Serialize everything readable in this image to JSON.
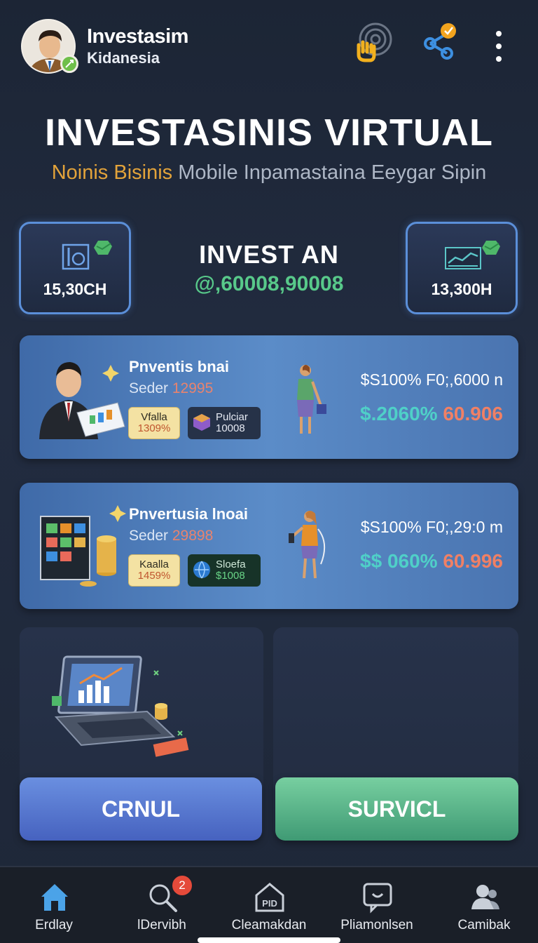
{
  "header": {
    "brand_title": "Investasim",
    "brand_sub": "Kidanesia"
  },
  "hero": {
    "title": "INVESTASINIS VIRTUAL",
    "subtitle_accent": "Noinis Bisinis",
    "subtitle_rest": " Mobile Inpamastaina Eeygar Sipin"
  },
  "stats": {
    "left_value": "15,30CH",
    "right_value": "13,300H",
    "center_label": "INVEST AN",
    "center_value": "@,60008,90008"
  },
  "cards": [
    {
      "name": "Pnventis bnai",
      "sub_label": "Seder ",
      "sub_number": "12995",
      "chip1_label": "Vfalla",
      "chip1_value": "1309%",
      "chip2_label": "Pulciar",
      "chip2_value": "10008",
      "stat_line": "$S100% F0;,6000 n",
      "stat_green": "$.2060%",
      "stat_red": " 60.906"
    },
    {
      "name": "Pnvertusia lnoai",
      "sub_label": "Seder ",
      "sub_number": "29898",
      "chip1_label": "Kaalla",
      "chip1_value": "1459%",
      "chip2_label": "Sloefa",
      "chip2_value": "$1008",
      "stat_line": "$S100% F0;,29:0 m",
      "stat_green": "$$ 060%",
      "stat_red": " 60.996"
    }
  ],
  "buttons": {
    "left": "CRNUL",
    "right": "SURVICL"
  },
  "nav": {
    "items": [
      {
        "label": "Erdlay",
        "icon": "home-icon"
      },
      {
        "label": "lDervibh",
        "icon": "search-icon",
        "badge": "2"
      },
      {
        "label": "Cleamakdan",
        "icon": "house-pid-icon",
        "icon_text": "PID"
      },
      {
        "label": "Pliamonlsen",
        "icon": "chat-icon"
      },
      {
        "label": "Camibak",
        "icon": "users-icon"
      }
    ]
  },
  "colors": {
    "accent_gold": "#e3a33a",
    "value_green": "#58c98a",
    "card_blue": "#5b8cc8",
    "button_blue": "#4662bf",
    "button_green": "#3f9a74",
    "badge_red": "#e54a3a"
  }
}
